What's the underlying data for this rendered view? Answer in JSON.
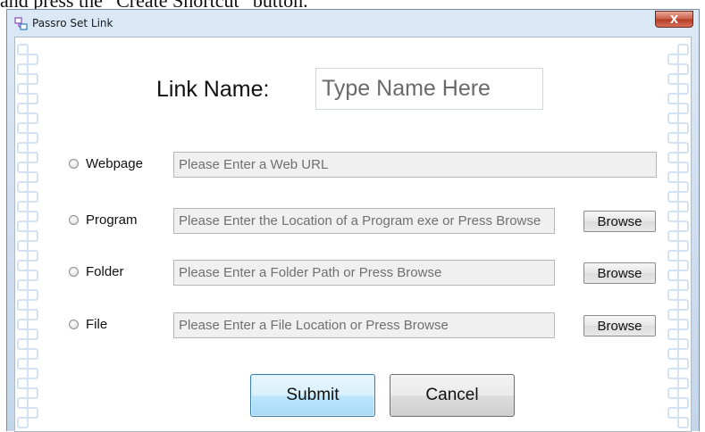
{
  "caption": "and press the “Create Shortcut” button.",
  "window": {
    "title": "Passro Set Link",
    "close_glyph": "X",
    "icon": "app-link-icon"
  },
  "link_name": {
    "label": "Link Name:",
    "placeholder": "Type Name Here"
  },
  "options": [
    {
      "label": "Webpage",
      "placeholder": "Please Enter a Web URL",
      "has_browse": false
    },
    {
      "label": "Program",
      "placeholder": "Please Enter the Location of a Program exe or Press Browse",
      "has_browse": true
    },
    {
      "label": "Folder",
      "placeholder": "Please Enter a Folder Path or Press Browse",
      "has_browse": true
    },
    {
      "label": "File",
      "placeholder": "Please Enter a File Location or Press Browse",
      "has_browse": true
    }
  ],
  "browse_label": "Browse",
  "buttons": {
    "submit": "Submit",
    "cancel": "Cancel"
  },
  "colors": {
    "frame": "#c4d6ea",
    "submit_border": "#3c7fb1",
    "close_red": "#c95d48",
    "chain": "#c5daf0"
  }
}
